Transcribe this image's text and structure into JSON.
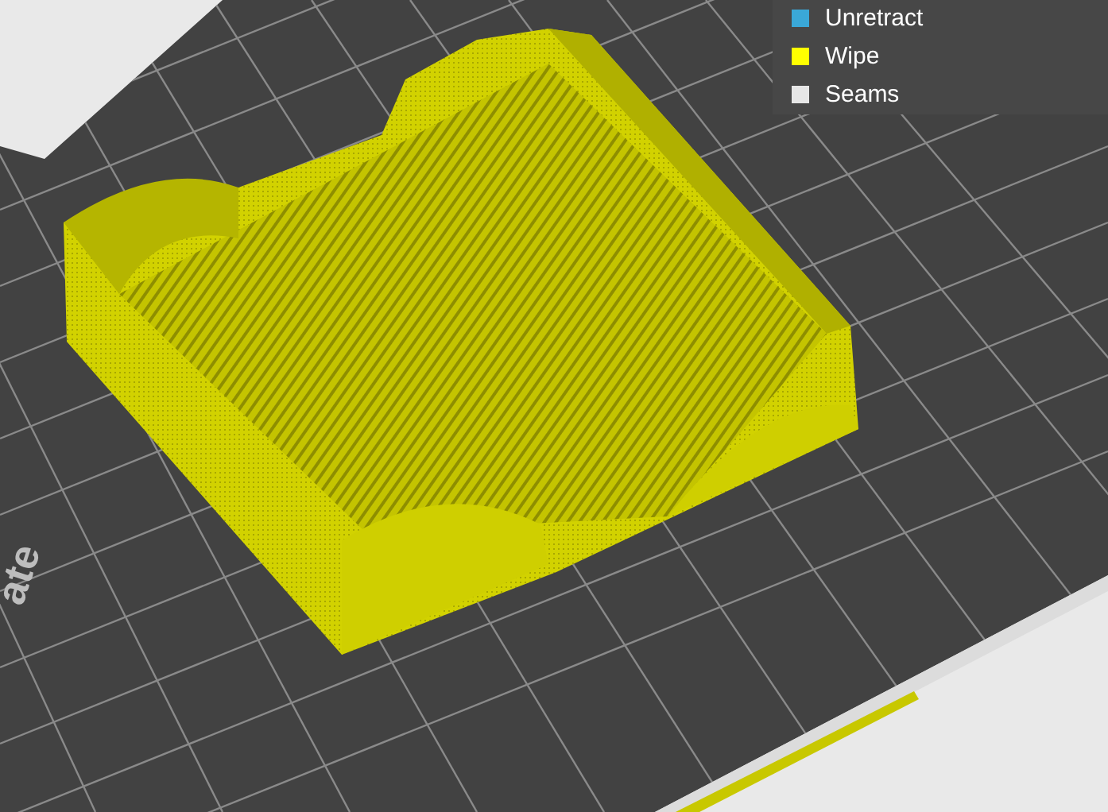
{
  "legend": {
    "items": [
      {
        "label": "Unretract",
        "color": "#3aa8d8"
      },
      {
        "label": "Wipe",
        "color": "#ffff00"
      },
      {
        "label": "Seams",
        "color": "#e6e6e6"
      }
    ]
  },
  "plate_label": "ate"
}
